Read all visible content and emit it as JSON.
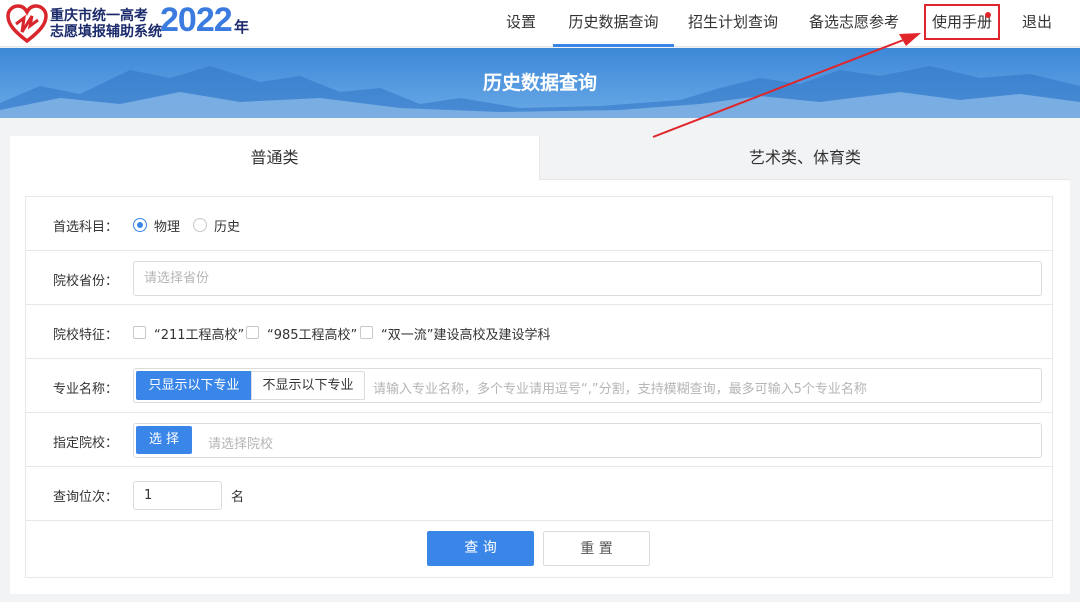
{
  "header": {
    "logo_line1": "重庆市统一高考",
    "logo_line2": "志愿填报辅助系统",
    "logo_year": "2022",
    "logo_year_suffix": "年",
    "nav": [
      {
        "label": "设置"
      },
      {
        "label": "历史数据查询"
      },
      {
        "label": "招生计划查询"
      },
      {
        "label": "备选志愿参考"
      },
      {
        "label": "使用手册"
      },
      {
        "label": "退出"
      }
    ]
  },
  "banner": {
    "title": "历史数据查询"
  },
  "tabs": [
    {
      "label": "普通类"
    },
    {
      "label": "艺术类、体育类"
    }
  ],
  "form": {
    "subject": {
      "label": "首选科目：",
      "options": [
        "物理",
        "历史"
      ],
      "selected": "物理"
    },
    "province": {
      "label": "院校省份：",
      "placeholder": "请选择省份"
    },
    "features": {
      "label": "院校特征：",
      "options": [
        "“211工程高校”",
        "“985工程高校”",
        "“双一流”建设高校及建设学科"
      ]
    },
    "major": {
      "label": "专业名称：",
      "show_only": "只显示以下专业",
      "hide": "不显示以下专业",
      "placeholder": "请输入专业名称，多个专业请用逗号“,”分割，支持模糊查询，最多可输入5个专业名称"
    },
    "school": {
      "label": "指定院校：",
      "select_label": "选 择",
      "placeholder": "请选择院校"
    },
    "rank": {
      "label": "查询位次：",
      "value": "1",
      "unit": "名"
    }
  },
  "buttons": {
    "query": "查 询",
    "reset": "重 置"
  },
  "colors": {
    "primary": "#3a86e8",
    "highlight": "#e0262a",
    "logo_dark": "#1b2a6b"
  }
}
